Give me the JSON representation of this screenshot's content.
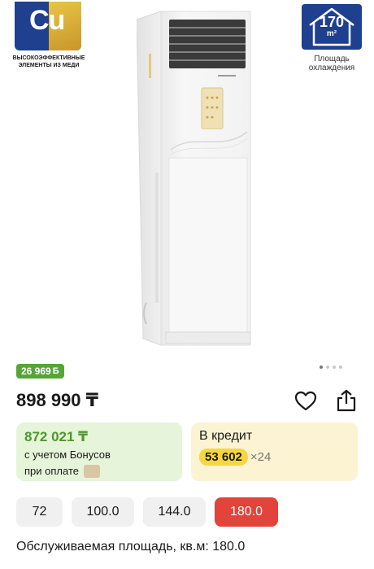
{
  "badges": {
    "copper_symbol": "Cu",
    "copper_caption": "ВЫСОКОЭФФЕКТИВНЫЕ ЭЛЕМЕНТЫ ИЗ МЕДИ",
    "area_value": "170",
    "area_unit": "m²",
    "area_caption": "Площадь охлаждения"
  },
  "gallery": {
    "total_dots": 4,
    "active_dot": 0
  },
  "bonus": {
    "value": "26 969",
    "icon": "bonus-b-icon",
    "symbol": "Б"
  },
  "price": "898 990 ₸",
  "actions": {
    "favorite_icon": "heart-icon",
    "share_icon": "share-icon"
  },
  "bonus_card": {
    "amount": "872 021 ₸",
    "line1": "с учетом Бонусов",
    "line2": "при оплате",
    "pay_icon": "payment-app-icon"
  },
  "credit_card": {
    "title": "В кредит",
    "monthly": "53 602",
    "term": "×24"
  },
  "options": [
    {
      "label": "72",
      "selected": false
    },
    {
      "label": "100.0",
      "selected": false
    },
    {
      "label": "144.0",
      "selected": false
    },
    {
      "label": "180.0",
      "selected": true
    }
  ],
  "spec": {
    "label": "Обслуживаемая площадь, кв.м: 180.0"
  },
  "colors": {
    "brand_blue": "#1f3f8f",
    "bonus_green": "#57a536",
    "selected_red": "#e2433a",
    "credit_yellow": "#f6d740"
  }
}
